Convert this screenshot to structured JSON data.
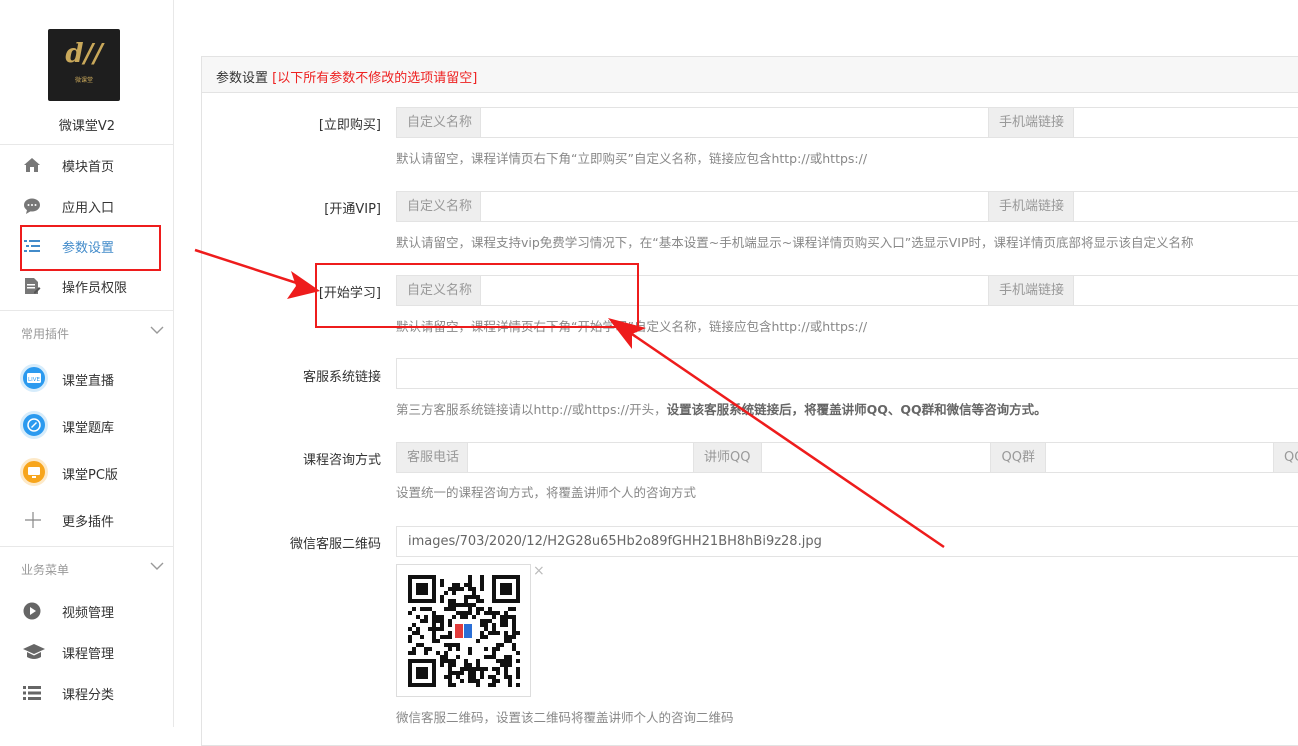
{
  "app": {
    "name": "微课堂V2",
    "logo_mark": "d//",
    "logo_sub": "微课堂"
  },
  "sidebar": {
    "items": [
      {
        "label": "模块首页",
        "icon": "home-icon"
      },
      {
        "label": "应用入口",
        "icon": "chat-bubble-icon"
      },
      {
        "label": "参数设置",
        "icon": "list-settings-icon",
        "active": true
      },
      {
        "label": "操作员权限",
        "icon": "document-edit-icon"
      }
    ],
    "section_plugins": {
      "title": "常用插件",
      "items": [
        {
          "label": "课堂直播",
          "icon": "live-tv-icon"
        },
        {
          "label": "课堂题库",
          "icon": "question-bank-icon"
        },
        {
          "label": "课堂PC版",
          "icon": "pc-monitor-icon"
        },
        {
          "label": "更多插件",
          "icon": "plus-icon"
        }
      ]
    },
    "section_business": {
      "title": "业务菜单",
      "items": [
        {
          "label": "视频管理",
          "icon": "play-circle-icon"
        },
        {
          "label": "课程管理",
          "icon": "graduation-cap-icon"
        },
        {
          "label": "课程分类",
          "icon": "list-icon"
        }
      ]
    }
  },
  "panel": {
    "title": "参数设置",
    "warning": "[以下所有参数不修改的选项请留空]"
  },
  "form": {
    "buy_now": {
      "label": "[立即购买]",
      "name_addon": "自定义名称",
      "link_addon": "手机端链接",
      "help": "默认请留空，课程详情页右下角“立即购买”自定义名称，链接应包含http://或https://"
    },
    "open_vip": {
      "label": "[开通VIP]",
      "name_addon": "自定义名称",
      "link_addon": "手机端链接",
      "help": "默认请留空，课程支持vip免费学习情况下，在“基本设置~手机端显示~课程详情页购买入口”选显示VIP时，课程详情页底部将显示该自定义名称"
    },
    "start_learning": {
      "label": "[开始学习]",
      "name_addon": "自定义名称",
      "link_addon": "手机端链接",
      "help": "默认请留空，课程详情页右下角“开始学习”自定义名称，链接应包含http://或https://"
    },
    "service_link": {
      "label": "客服系统链接",
      "value": "",
      "help_normal": "第三方客服系统链接请以http://或https://开头，",
      "help_bold": "设置该客服系统链接后，将覆盖讲师QQ、QQ群和微信等咨询方式。"
    },
    "consult": {
      "label": "课程咨询方式",
      "phone_addon": "客服电话",
      "qq_addon": "讲师QQ",
      "qqgroup_addon": "QQ群",
      "last_addon": "QQ",
      "help": "设置统一的课程咨询方式，将覆盖讲师个人的咨询方式"
    },
    "wechat_qr": {
      "label": "微信客服二维码",
      "value": "images/703/2020/12/H2G28u65Hb2o89fGHH21BH8hBi9z28.jpg",
      "close": "×",
      "help": "微信客服二维码，设置该二维码将覆盖讲师个人的咨询二维码"
    }
  },
  "colors": {
    "annotation": "#ee1c1c",
    "active": "#428bca",
    "warning": "#ee2222"
  }
}
